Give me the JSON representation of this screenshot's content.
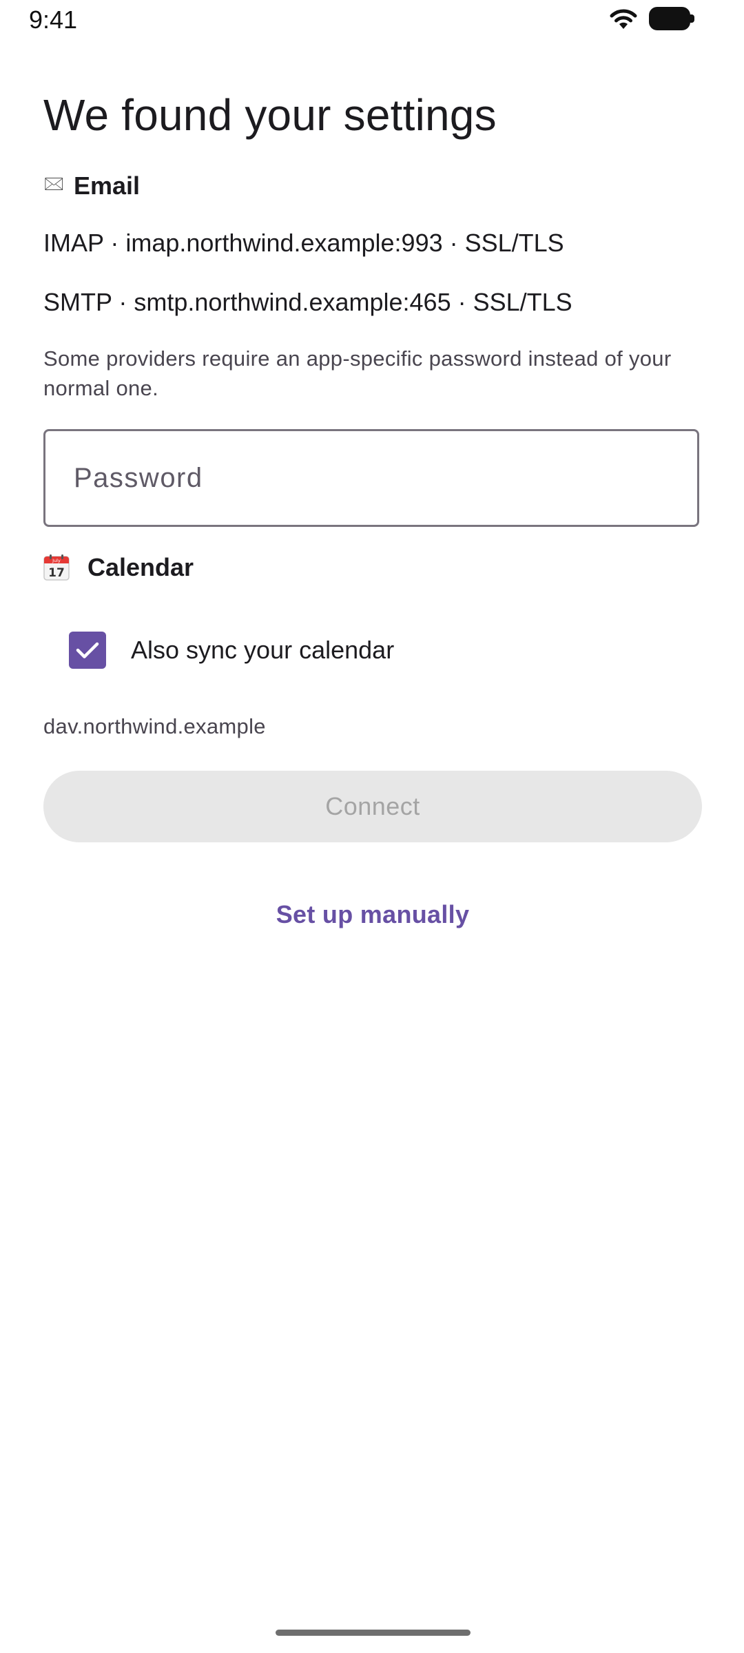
{
  "status_bar": {
    "time": "9:41",
    "wifi_icon": "wifi-icon",
    "battery_icon": "battery-icon"
  },
  "title": "We found your settings",
  "email_section": {
    "icon": "envelope-icon",
    "icon_glyph": "🖂",
    "label": "Email",
    "imap_line": "IMAP · imap.northwind.example:993 · SSL/TLS",
    "smtp_line": "SMTP · smtp.northwind.example:465 · SSL/TLS",
    "hint": "Some providers require an app-specific password instead of your normal one.",
    "password_value": "",
    "password_placeholder": "Password"
  },
  "calendar_section": {
    "icon": "calendar-icon",
    "icon_month": "July",
    "icon_day": "17",
    "label": "Calendar",
    "sync_checkbox_label": "Also sync your calendar",
    "sync_checked": true,
    "host": "dav.northwind.example"
  },
  "actions": {
    "connect_label": "Connect",
    "connect_enabled": false,
    "manual_label": "Set up manually"
  },
  "colors": {
    "accent": "#6750a4",
    "disabled_bg": "#e7e7e7",
    "disabled_text": "#a4a4a4",
    "outline": "#79747e",
    "secondary_text": "#49454f"
  }
}
